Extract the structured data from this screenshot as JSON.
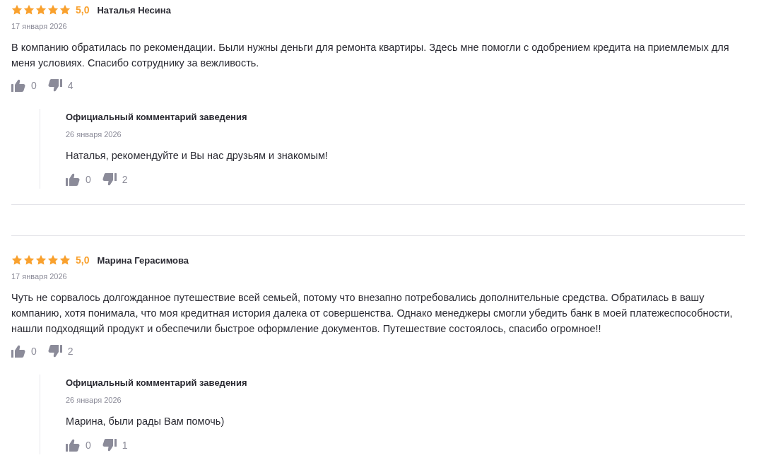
{
  "reviews": [
    {
      "stars": 5,
      "rating": "5,0",
      "author": "Наталья Несина",
      "date": "17 января 2026",
      "text": "В компанию обратилась по рекомендации. Были нужны деньги для ремонта квартиры. Здесь мне помогли с одобрением кредита на приемлемых для меня условиях. Спасибо сотруднику за вежливость.",
      "likes": "0",
      "dislikes": "4",
      "reply": {
        "title": "Официальный комментарий заведения",
        "date": "26 января 2026",
        "text": "Наталья, рекомендуйте и Вы нас друзьям и знакомым!",
        "likes": "0",
        "dislikes": "2"
      }
    },
    {
      "stars": 5,
      "rating": "5,0",
      "author": "Марина Герасимова",
      "date": "17 января 2026",
      "text": "Чуть не сорвалось долгожданное путешествие всей семьей, потому что внезапно потребовались дополнительные средства. Обратилась в вашу компанию, хотя понимала, что моя кредитная история далека от совершенства. Однако менеджеры смогли убедить банк в моей платежеспособности, нашли подходящий продукт и обеспечили быстрое оформление документов. Путешествие состоялось, спасибо огромное!!",
      "likes": "0",
      "dislikes": "2",
      "reply": {
        "title": "Официальный комментарий заведения",
        "date": "26 января 2026",
        "text": "Марина, были рады Вам помочь)",
        "likes": "0",
        "dislikes": "1"
      }
    }
  ]
}
